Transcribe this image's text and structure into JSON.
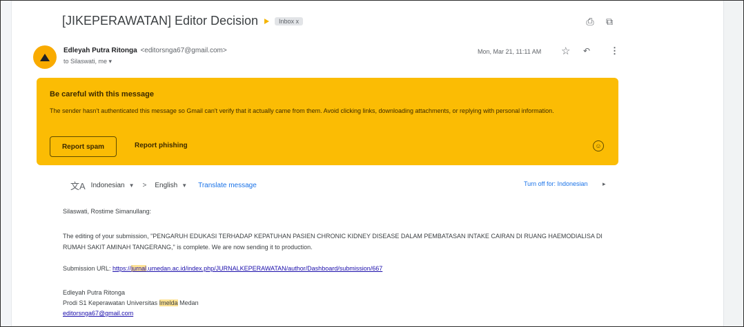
{
  "email": {
    "subject": "[JIKEPERAWATAN] Editor Decision",
    "label_chip": "Inbox x",
    "sender": {
      "name": "Edleyah Putra Ritonga",
      "email": "<editorsnga67@gmail.com>",
      "to_line": "to Silaswati, me ▾",
      "date": "Mon, Mar 21, 11:11 AM"
    }
  },
  "warning": {
    "title": "Be careful with this message",
    "text": "The sender hasn't authenticated this message so Gmail can't verify that it actually came from them. Avoid clicking links, downloading attachments, or replying with personal information.",
    "report_spam_label": "Report spam",
    "report_phishing_label": "Report phishing"
  },
  "translate": {
    "from_lang": "Indonesian",
    "to_lang": "English",
    "translate_link": "Translate message",
    "turn_off": "Turn off for: Indonesian"
  },
  "body": {
    "greeting": "Silaswati, Rostime Simanullang:",
    "para1": "The editing of your submission, \"PENGARUH EDUKASI TERHADAP KEPATUHAN PASIEN CHRONIC KIDNEY DISEASE DALAM PEMBATASAN INTAKE CAIRAN DI RUANG HAEMODIALISA DI RUMAH SAKIT AMINAH TANGERANG,\" is complete. We are now sending it to production.",
    "submission_label": "Submission URL:",
    "url_pre": "https://",
    "url_highlight": "jurnal",
    "url_post": ".umedan.ac.id/index.php/JURNALKEPERAWATAN/author/Dashboard/submission/667",
    "sig_name": "Edleyah Putra Ritonga",
    "sig_line2_pre": "Prodi S1 Keperawatan Universitas ",
    "sig_line2_highlight": "Imelda",
    "sig_line2_post": " Medan",
    "sig_email": "editorsnga67@gmail.com"
  },
  "icons": {
    "print": "print-icon",
    "popout": "open-in-new-icon",
    "star": "star-icon",
    "reply": "reply-icon",
    "more": "more-vert-icon",
    "translate": "translate-icon",
    "warning_avatar": "warning-icon",
    "feedback": "smiley-icon"
  },
  "colors": {
    "warning_bg": "#fbbc04",
    "avatar_bg": "#f9ab00",
    "link": "#1a0dab",
    "highlight": "#fde293"
  }
}
